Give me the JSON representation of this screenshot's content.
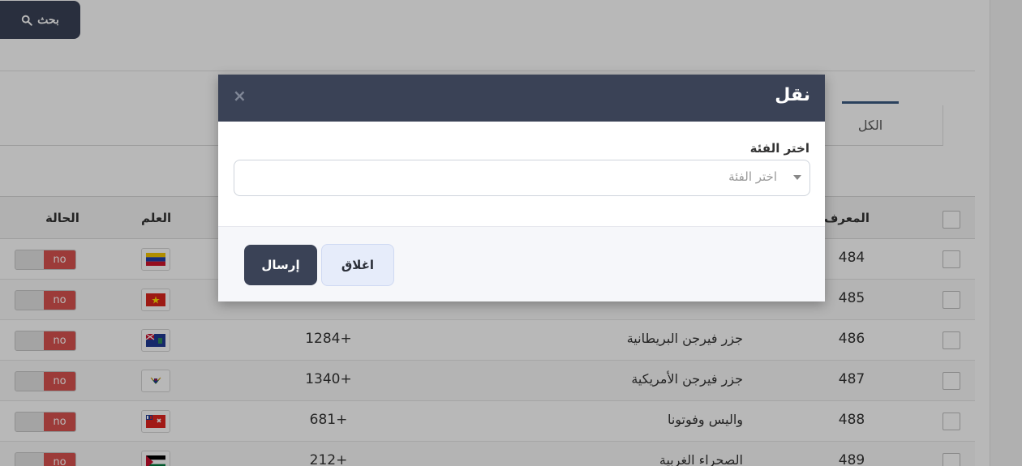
{
  "toolbar": {
    "search_label": "بحث"
  },
  "tabs": {
    "all_label": "الكل"
  },
  "table": {
    "headers": {
      "id": "المعرف",
      "flag": "العلم",
      "status": "الحالة"
    },
    "rows": [
      {
        "id": "484",
        "name": "",
        "code": "",
        "flag_icon": "venezuela-flag-icon",
        "status": "no"
      },
      {
        "id": "485",
        "name": "",
        "code": "",
        "flag_icon": "vietnam-flag-icon",
        "status": "no"
      },
      {
        "id": "486",
        "name": "جزر فيرجن البريطانية",
        "code": "1284+",
        "flag_icon": "british-virgin-islands-flag-icon",
        "status": "no"
      },
      {
        "id": "487",
        "name": "جزر فيرجن الأمريكية",
        "code": "1340+",
        "flag_icon": "us-virgin-islands-flag-icon",
        "status": "no"
      },
      {
        "id": "488",
        "name": "واليس وفوتونا",
        "code": "681+",
        "flag_icon": "wallis-futuna-flag-icon",
        "status": "no"
      },
      {
        "id": "489",
        "name": "الصحراء الغربية",
        "code": "212+",
        "flag_icon": "western-sahara-flag-icon",
        "status": "no"
      }
    ]
  },
  "modal": {
    "title": "نقل",
    "close_icon": "×",
    "field_label": "اختر الفئة",
    "select_placeholder": "اختر الفئة",
    "send_label": "إرسال",
    "close_label": "اغلاق"
  },
  "colors": {
    "primary_dark": "#3a4256",
    "status_off": "#d9534f",
    "tab_accent": "#3b5b82"
  }
}
